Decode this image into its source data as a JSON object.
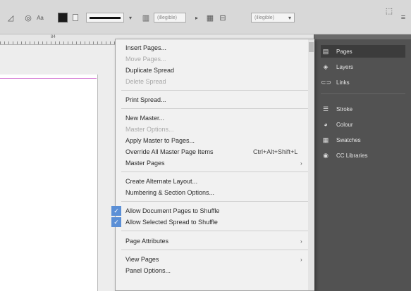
{
  "toolbar": {
    "stroke_weight": "(illegible)",
    "opacity_value": "(illegible)",
    "zoom_value": "(illegible)"
  },
  "ruler": {
    "ticks": [
      "84"
    ]
  },
  "menu": {
    "items": [
      {
        "label": "Insert Pages...",
        "enabled": true
      },
      {
        "label": "Move Pages...",
        "enabled": false
      },
      {
        "label": "Duplicate Spread",
        "enabled": true
      },
      {
        "label": "Delete Spread",
        "enabled": false
      },
      {
        "separator": true
      },
      {
        "label": "Print Spread...",
        "enabled": true
      },
      {
        "separator": true
      },
      {
        "label": "New Master...",
        "enabled": true
      },
      {
        "label": "Master Options...",
        "enabled": false
      },
      {
        "label": "Apply Master to Pages...",
        "enabled": true
      },
      {
        "label": "Override All Master Page Items",
        "enabled": true,
        "shortcut": "Ctrl+Alt+Shift+L"
      },
      {
        "label": "Master Pages",
        "enabled": true,
        "submenu": true
      },
      {
        "separator": true
      },
      {
        "label": "Create Alternate Layout...",
        "enabled": true
      },
      {
        "label": "Numbering & Section Options...",
        "enabled": true
      },
      {
        "separator": true
      },
      {
        "label": "Allow Document Pages to Shuffle",
        "enabled": true,
        "checked": true
      },
      {
        "label": "Allow Selected Spread to Shuffle",
        "enabled": true,
        "checked": true
      },
      {
        "separator": true
      },
      {
        "label": "Page Attributes",
        "enabled": true,
        "submenu": true
      },
      {
        "separator": true
      },
      {
        "label": "View Pages",
        "enabled": true,
        "submenu": true
      },
      {
        "label": "Panel Options...",
        "enabled": true
      }
    ]
  },
  "panels": {
    "items": [
      {
        "label": "Pages",
        "icon": "pages-icon",
        "active": true
      },
      {
        "label": "Layers",
        "icon": "layers-icon",
        "active": false
      },
      {
        "label": "Links",
        "icon": "links-icon",
        "active": false
      },
      {
        "separator": true
      },
      {
        "label": "Stroke",
        "icon": "stroke-icon",
        "active": false
      },
      {
        "label": "Colour",
        "icon": "colour-icon",
        "active": false
      },
      {
        "label": "Swatches",
        "icon": "swatches-icon",
        "active": false
      },
      {
        "label": "CC Libraries",
        "icon": "cc-libraries-icon",
        "active": false
      }
    ]
  },
  "colors": {
    "menu_bg": "#f1f1f1",
    "check_blue": "#5b8fd6",
    "panel_bg": "#525252",
    "guide_magenta": "#d47ad4"
  }
}
